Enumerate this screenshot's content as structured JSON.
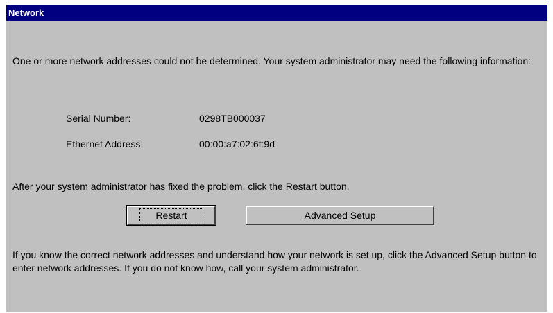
{
  "window": {
    "title": "Network"
  },
  "message": {
    "intro": "One or more network addresses could not be determined.  Your system administrator may need the following information:",
    "fixed": "After your system administrator has fixed the problem, click the Restart button.",
    "advanced": "If you know the correct network addresses and understand how your network is set up, click the Advanced Setup button to enter network addresses.  If you do not know how, call your system administrator."
  },
  "info": {
    "serial_label": "Serial Number:",
    "serial_value": "0298TB000037",
    "ethernet_label": "Ethernet Address:",
    "ethernet_value": "00:00:a7:02:6f:9d"
  },
  "buttons": {
    "restart": {
      "mnemonic": "R",
      "rest": "estart"
    },
    "advanced": {
      "mnemonic": "A",
      "rest": "dvanced Setup"
    }
  }
}
